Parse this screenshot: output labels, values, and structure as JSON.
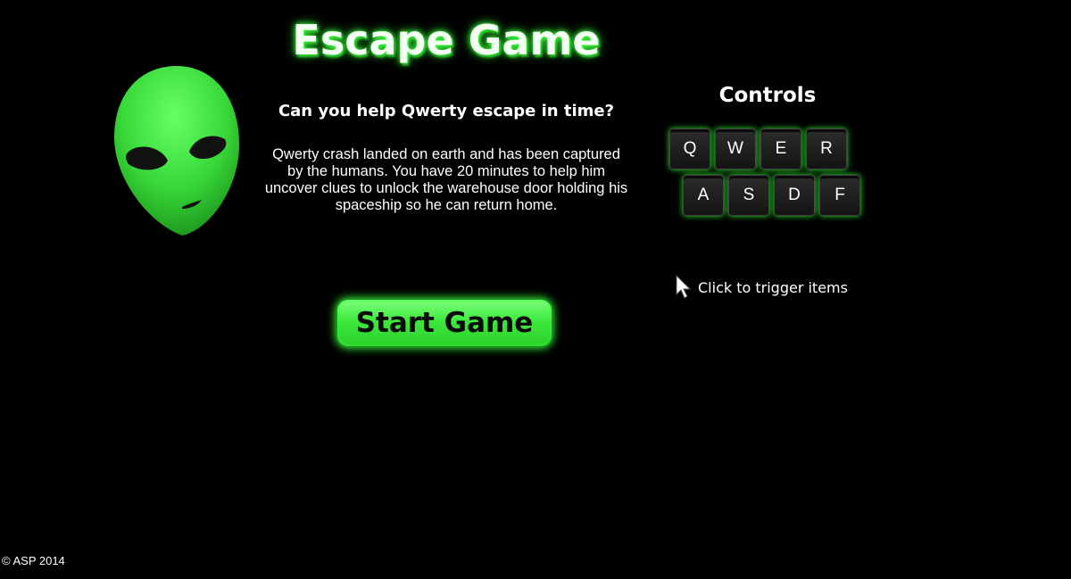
{
  "header": {
    "title": "Escape Game",
    "subtitle": "Can you help Qwerty escape in time?"
  },
  "intro": {
    "story": "Qwerty crash landed on earth and has been captured by the humans. You have 20 minutes to help him uncover clues to unlock the warehouse door holding his spaceship so he can return home."
  },
  "start_button": {
    "label": "Start Game"
  },
  "controls": {
    "title": "Controls",
    "row1": [
      "Q",
      "W",
      "E",
      "R"
    ],
    "row2": [
      "A",
      "S",
      "D",
      "F"
    ],
    "click_hint": "Click to trigger items",
    "cursor_icon": "mouse-pointer-icon"
  },
  "footer": {
    "copyright": "© ASP 2014"
  },
  "colors": {
    "background": "#000000",
    "accent_green": "#3ee83e",
    "alien_green": "#3ddc3d"
  }
}
